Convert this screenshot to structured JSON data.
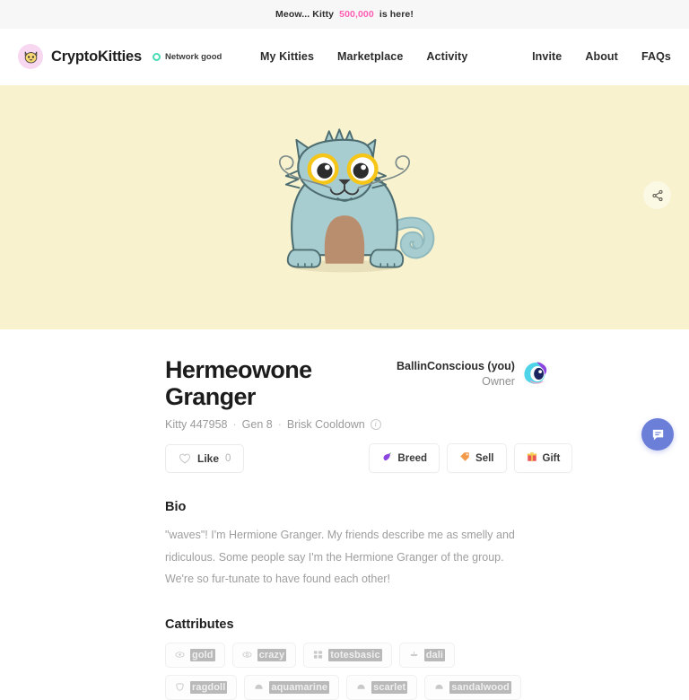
{
  "announcement": {
    "prefix": "Meow... Kitty ",
    "highlight": "500,000",
    "suffix": " is here!",
    "highlight_color": "#ff5eb4"
  },
  "header": {
    "brand": "CryptoKitties",
    "logo_icon": "cat-face-icon",
    "network_status": "Network good",
    "network_color": "#46dbb4",
    "nav_primary": [
      {
        "label": "My Kitties"
      },
      {
        "label": "Marketplace"
      },
      {
        "label": "Activity"
      }
    ],
    "nav_secondary": [
      {
        "label": "Invite"
      },
      {
        "label": "About"
      },
      {
        "label": "FAQs"
      }
    ]
  },
  "hero": {
    "background_color": "#f8f2cf",
    "share_icon": "share-icon",
    "kitty": {
      "body_color": "#9dc9cd",
      "belly_color": "#b98e6e",
      "eye_color": "#f5c518"
    }
  },
  "kitty": {
    "name": "Hermeowone Granger",
    "id_label": "Kitty 447958",
    "generation": "Gen 8",
    "cooldown": "Brisk Cooldown",
    "info_icon": "info-icon"
  },
  "owner": {
    "name": "BallinConscious (you)",
    "role": "Owner",
    "avatar_icon": "owner-avatar-icon"
  },
  "actions": {
    "like_label": "Like",
    "like_count": "0",
    "like_icon": "heart-icon",
    "buttons": [
      {
        "label": "Breed",
        "icon": "breed-icon"
      },
      {
        "label": "Sell",
        "icon": "tag-icon"
      },
      {
        "label": "Gift",
        "icon": "gift-icon"
      }
    ]
  },
  "bio": {
    "heading": "Bio",
    "text": "\"waves\"! I'm Hermione Granger. My friends describe me as smelly and ridiculous. Some people say I'm the Hermione Granger of the group. We're so fur-tunate to have found each other!"
  },
  "cattributes": {
    "heading": "Cattributes",
    "items": [
      {
        "label": "gold",
        "icon": "eye-icon"
      },
      {
        "label": "crazy",
        "icon": "eye-icon"
      },
      {
        "label": "totesbasic",
        "icon": "pattern-icon"
      },
      {
        "label": "dali",
        "icon": "mouth-icon"
      },
      {
        "label": "ragdoll",
        "icon": "body-icon"
      },
      {
        "label": "aquamarine",
        "icon": "color-icon"
      },
      {
        "label": "scarlet",
        "icon": "color-icon"
      },
      {
        "label": "sandalwood",
        "icon": "color-icon"
      }
    ]
  },
  "chat": {
    "icon": "chat-bubble-icon",
    "color": "#6c7fd8"
  }
}
